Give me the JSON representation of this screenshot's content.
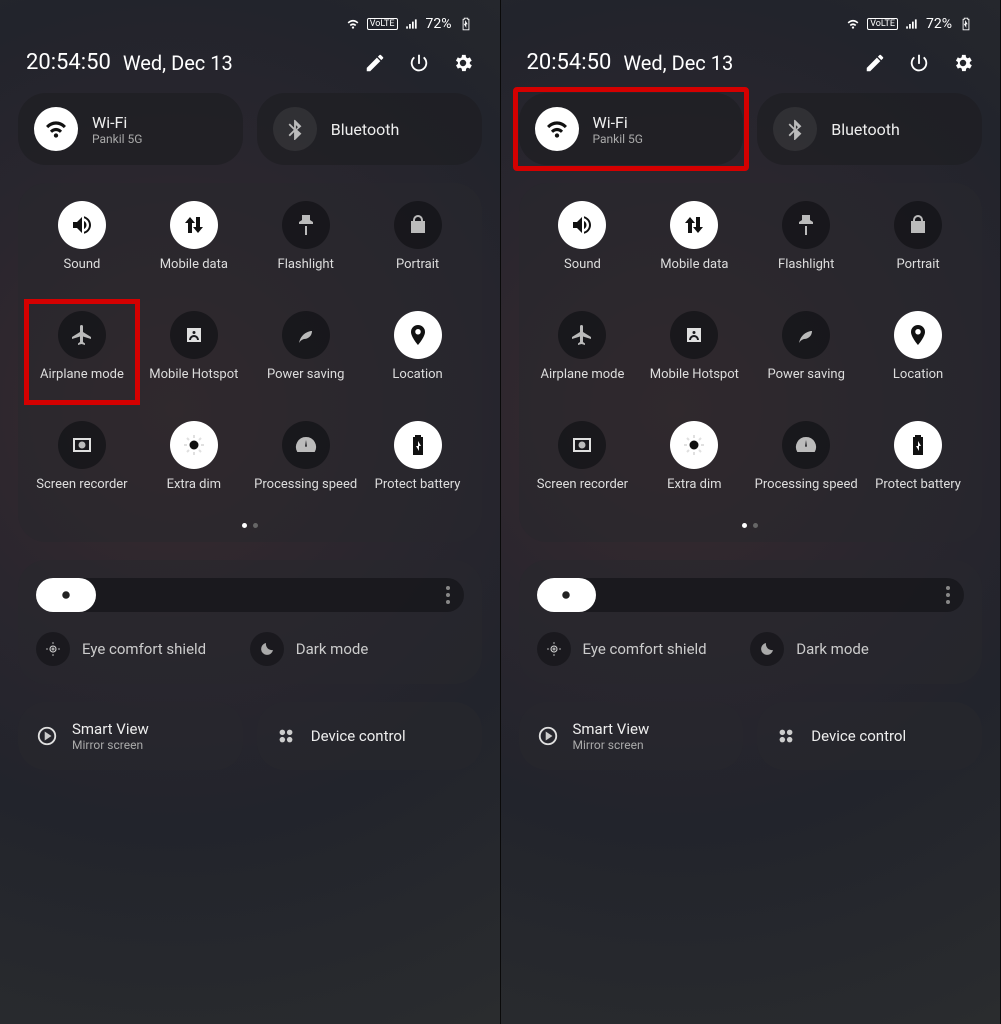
{
  "status": {
    "battery": "72%",
    "volte": "VoLTE"
  },
  "header": {
    "time": "20:54:50",
    "date": "Wed, Dec 13"
  },
  "top": {
    "wifi": {
      "title": "Wi-Fi",
      "sub": "Pankil 5G"
    },
    "bluetooth": {
      "title": "Bluetooth"
    }
  },
  "grid": {
    "sound": "Sound",
    "mobile_data": "Mobile data",
    "flashlight": "Flashlight",
    "portrait": "Portrait",
    "airplane": "Airplane mode",
    "hotspot": "Mobile Hotspot",
    "power_saving": "Power saving",
    "location": "Location",
    "screen_recorder": "Screen recorder",
    "extra_dim": "Extra dim",
    "processing": "Processing speed",
    "protect_battery": "Protect battery"
  },
  "brightness": {
    "eye_comfort": "Eye comfort shield",
    "dark_mode": "Dark mode",
    "level_percent": 14
  },
  "bottom": {
    "smart_view": {
      "title": "Smart View",
      "sub": "Mirror screen"
    },
    "device_control": {
      "title": "Device control"
    }
  },
  "highlights": {
    "left": "airplane-mode-tile",
    "right": "wifi-tile"
  }
}
